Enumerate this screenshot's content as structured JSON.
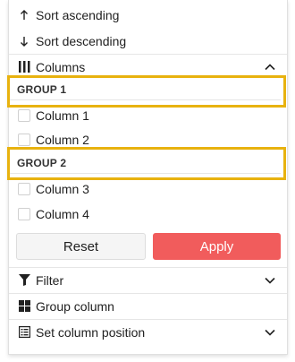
{
  "menu": {
    "sort_ascending": {
      "label": "Sort ascending",
      "icon": "arrow-up-icon"
    },
    "sort_descending": {
      "label": "Sort descending",
      "icon": "arrow-down-icon"
    },
    "columns": {
      "label": "Columns",
      "icon": "columns-icon",
      "expanded": true
    },
    "filter": {
      "label": "Filter",
      "icon": "filter-icon"
    },
    "group_column": {
      "label": "Group column",
      "icon": "grid-icon"
    },
    "set_column_position": {
      "label": "Set column position",
      "icon": "list-icon"
    }
  },
  "columns_panel": {
    "groups": [
      {
        "title": "GROUP 1",
        "columns": [
          {
            "label": "Column 1",
            "checked": false
          },
          {
            "label": "Column 2",
            "checked": false
          }
        ]
      },
      {
        "title": "GROUP 2",
        "columns": [
          {
            "label": "Column 3",
            "checked": false
          },
          {
            "label": "Column 4",
            "checked": false
          }
        ]
      }
    ],
    "reset_label": "Reset",
    "apply_label": "Apply"
  },
  "colors": {
    "highlight": "#e8b20f",
    "apply_button": "#f15c5c",
    "reset_button": "#f5f5f5"
  }
}
